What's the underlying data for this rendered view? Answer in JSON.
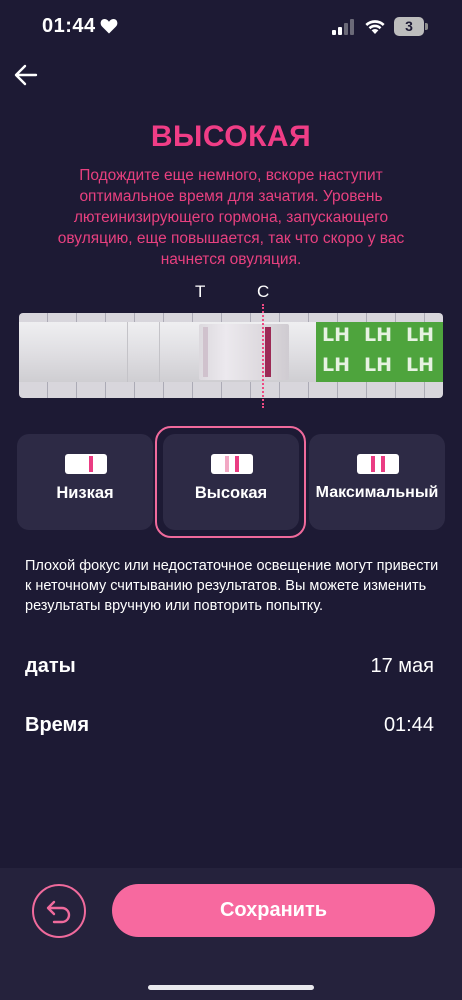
{
  "status_bar": {
    "time": "01:44",
    "battery_level": "3",
    "icons": [
      "heart-icon",
      "signal-icon",
      "wifi-icon",
      "battery-icon"
    ]
  },
  "header": {
    "back_icon": "arrow-left-icon"
  },
  "result": {
    "level": "ВЫСОКАЯ",
    "description": "Подождите еще немного, вскоре наступит оптимальное время для зачатия. Уровень лютеинизирующего гормона, запускающего овуляцию, еще повышается, так что скоро у вас начнется овуляция."
  },
  "strip": {
    "label_t": "T",
    "label_c": "C",
    "lh_marks": [
      "LH",
      "LH",
      "LH",
      "LH",
      "LH",
      "LH"
    ]
  },
  "levels": [
    {
      "label": "Низкая",
      "selected": false
    },
    {
      "label": "Высокая",
      "selected": true
    },
    {
      "label": "Максимальный",
      "selected": false
    }
  ],
  "warning": "Плохой фокус или недостаточное освещение могут привести к неточному считыванию результатов. Вы можете изменить результаты вручную или повторить попытку.",
  "fields": {
    "date_label": "даты",
    "date_value": "17 мая",
    "time_label": "Время",
    "time_value": "01:44"
  },
  "actions": {
    "undo_icon": "undo-icon",
    "save_label": "Сохранить"
  },
  "colors": {
    "background": "#1d1a34",
    "accent": "#f03d86",
    "button": "#f7699f",
    "card": "#2d2a45"
  }
}
